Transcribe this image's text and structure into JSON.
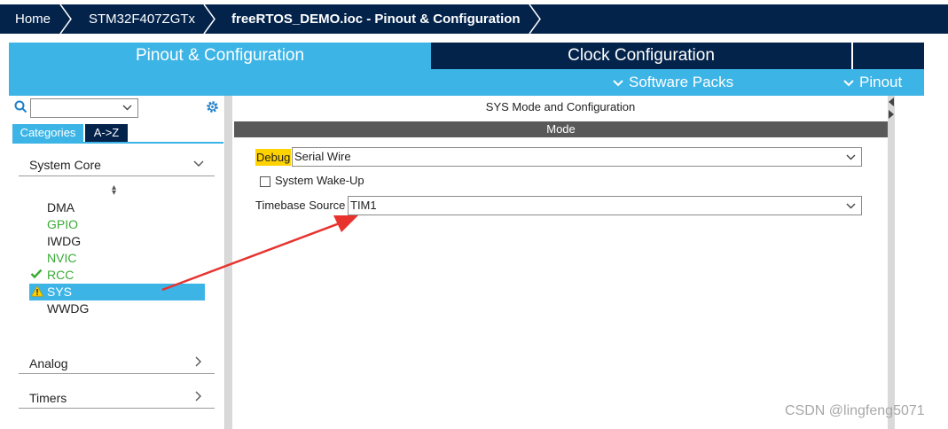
{
  "breadcrumb": {
    "items": [
      "Home",
      "STM32F407ZGTx",
      "freeRTOS_DEMO.ioc - Pinout & Configuration"
    ]
  },
  "tabs": {
    "pinout_label": "Pinout & Configuration",
    "clock_label": "Clock Configuration"
  },
  "subbar": {
    "software_packs": "Software Packs",
    "pinout": "Pinout"
  },
  "left": {
    "search": {
      "value": ""
    },
    "toggle": {
      "categories": "Categories",
      "az": "A->Z"
    },
    "system_core": {
      "label": "System Core",
      "items": [
        "DMA",
        "GPIO",
        "IWDG",
        "NVIC",
        "RCC",
        "SYS",
        "WWDG"
      ],
      "selected": "SYS"
    },
    "analog": {
      "label": "Analog"
    },
    "timers": {
      "label": "Timers"
    }
  },
  "right": {
    "title": "SYS Mode and Configuration",
    "mode_header": "Mode",
    "debug_label": "Debug",
    "debug_value": "Serial Wire",
    "wakeup_label": "System Wake-Up",
    "wakeup_checked": false,
    "timebase_label": "Timebase Source",
    "timebase_value": "TIM1"
  },
  "colors": {
    "navy": "#03234b",
    "accent": "#3cb4e6",
    "green": "#3aaa35",
    "warning": "#ffd200",
    "arrow": "#e8322e"
  },
  "watermark": "CSDN @lingfeng5071"
}
